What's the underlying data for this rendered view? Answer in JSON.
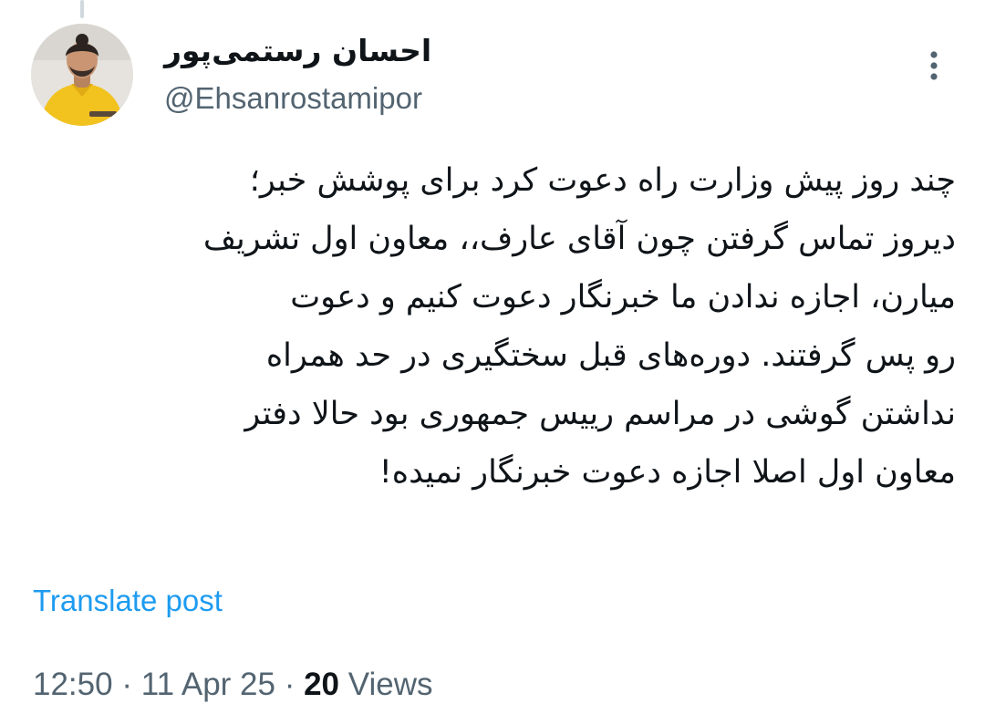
{
  "tweet": {
    "author": {
      "display_name": "احسان رستمی‌پور",
      "handle": "@Ehsanrostamipor",
      "avatar_icon": "person-avatar-icon"
    },
    "more_icon": "more-vertical-icon",
    "text": "چند روز پیش وزارت راه دعوت کرد برای پوشش خبر؛\nدیروز تماس گرفتن چون آقای عارف،، معاون اول تشریف\nمیارن، اجازه ندادن ما خبرنگار دعوت کنیم و دعوت\nرو پس گرفتند. دوره‌های قبل سختگیری در حد همراه\nنداشتن گوشی در مراسم رییس جمهوری بود حالا دفتر\nمعاون اول اصلا اجازه دعوت خبرنگار نمیده!",
    "translate_label": "Translate post",
    "time": "12:50",
    "separator": "·",
    "date": "11 Apr 25",
    "views_count": "20",
    "views_label": "Views"
  },
  "colors": {
    "link": "#1d9bf0",
    "secondary_text": "#536471",
    "primary_text": "#0f1419",
    "avatar_shirt": "#f2c21f"
  }
}
